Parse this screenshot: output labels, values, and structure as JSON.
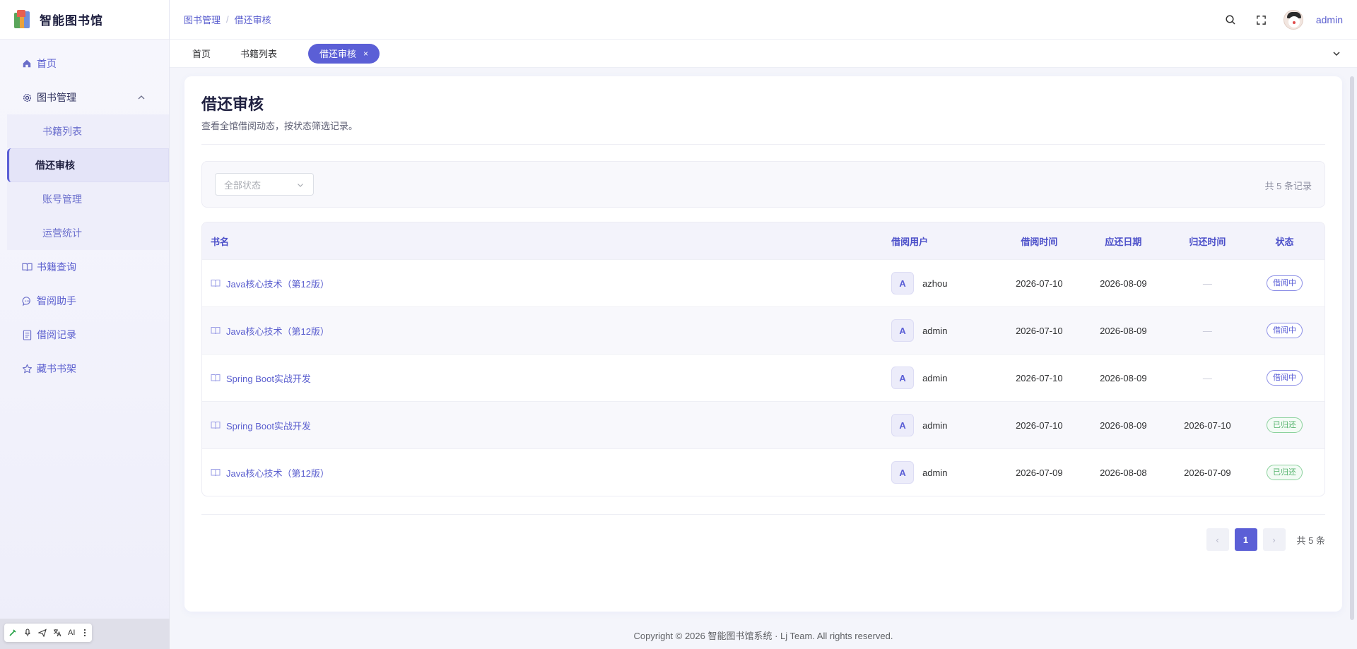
{
  "app": {
    "title": "智能图书馆"
  },
  "sidebar": {
    "items": [
      {
        "label": "首页",
        "icon": "home-icon"
      },
      {
        "label": "图书管理",
        "icon": "gear-icon",
        "expanded": true,
        "children": [
          {
            "label": "书籍列表"
          },
          {
            "label": "借还审核",
            "active": true
          },
          {
            "label": "账号管理"
          },
          {
            "label": "运营统计"
          }
        ]
      },
      {
        "label": "书籍查询",
        "icon": "book-open-icon"
      },
      {
        "label": "智阅助手",
        "icon": "chat-icon"
      },
      {
        "label": "借阅记录",
        "icon": "document-icon"
      },
      {
        "label": "藏书书架",
        "icon": "star-icon"
      }
    ]
  },
  "dock": {
    "ai_label": "AI"
  },
  "header": {
    "breadcrumb": [
      "图书管理",
      "借还审核"
    ],
    "user": "admin"
  },
  "tabs": [
    {
      "label": "首页"
    },
    {
      "label": "书籍列表"
    },
    {
      "label": "借还审核",
      "active": true,
      "close": "×"
    }
  ],
  "page": {
    "title": "借还审核",
    "subtitle": "查看全馆借阅动态，按状态筛选记录。",
    "filter": {
      "placeholder": "全部状态"
    },
    "record_count": "共 5 条记录"
  },
  "table": {
    "columns": [
      "书名",
      "借阅用户",
      "借阅时间",
      "应还日期",
      "归还时间",
      "状态"
    ],
    "rows": [
      {
        "title": "Java核心技术（第12版）",
        "avatar": "A",
        "user": "azhou",
        "borrow": "2026-07-10",
        "due": "2026-08-09",
        "returned": "—",
        "status": "借阅中",
        "status_type": "borrowing"
      },
      {
        "title": "Java核心技术（第12版）",
        "avatar": "A",
        "user": "admin",
        "borrow": "2026-07-10",
        "due": "2026-08-09",
        "returned": "—",
        "status": "借阅中",
        "status_type": "borrowing"
      },
      {
        "title": "Spring Boot实战开发",
        "avatar": "A",
        "user": "admin",
        "borrow": "2026-07-10",
        "due": "2026-08-09",
        "returned": "—",
        "status": "借阅中",
        "status_type": "borrowing"
      },
      {
        "title": "Spring Boot实战开发",
        "avatar": "A",
        "user": "admin",
        "borrow": "2026-07-10",
        "due": "2026-08-09",
        "returned": "2026-07-10",
        "status": "已归还",
        "status_type": "returned"
      },
      {
        "title": "Java核心技术（第12版）",
        "avatar": "A",
        "user": "admin",
        "borrow": "2026-07-09",
        "due": "2026-08-08",
        "returned": "2026-07-09",
        "status": "已归还",
        "status_type": "returned"
      }
    ]
  },
  "pagination": {
    "prev": "‹",
    "current": "1",
    "next": "›",
    "total": "共 5 条"
  },
  "footer": {
    "text": "Copyright © 2026 智能图书馆系统 · Lj Team. All rights reserved."
  },
  "colors": {
    "accent": "#5b5fd6",
    "returned": "#52b26a"
  }
}
